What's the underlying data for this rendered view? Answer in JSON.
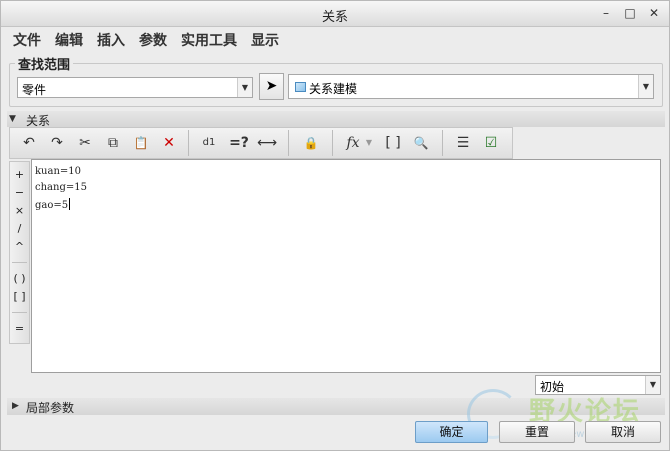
{
  "window": {
    "title": "关系",
    "controls": [
      "–",
      "□",
      "✕"
    ]
  },
  "menu": [
    "文件",
    "编辑",
    "插入",
    "参数",
    "实用工具",
    "显示"
  ],
  "scope": {
    "legend": "查找范围",
    "type_value": "零件",
    "model_value": "关系建模"
  },
  "section": {
    "label": "关系"
  },
  "toolbar": {
    "undo": "↶",
    "redo": "↷",
    "cut": "✂",
    "copy": "⧉",
    "paste": "📋",
    "delete": "✕",
    "switch_dims": "d1",
    "evaluate": "=?",
    "measure": "⟷",
    "show_params": "🔒",
    "function": "fx",
    "brackets": "[ ]",
    "insert_param": "🔍",
    "sort": "☰",
    "verify": "☑"
  },
  "operators": [
    "+",
    "−",
    "×",
    "/",
    "^",
    "( )",
    "[ ]",
    "="
  ],
  "editor": {
    "lines": [
      "kuan=10",
      "chang=15",
      "gao=5"
    ]
  },
  "units": {
    "value": "初始"
  },
  "local_params": {
    "label": "局部参数"
  },
  "buttons": {
    "ok": "确定",
    "reset": "重置",
    "cancel": "取消"
  },
  "watermark": {
    "text": "野火论坛",
    "url": "www.proewildfire.cn"
  }
}
